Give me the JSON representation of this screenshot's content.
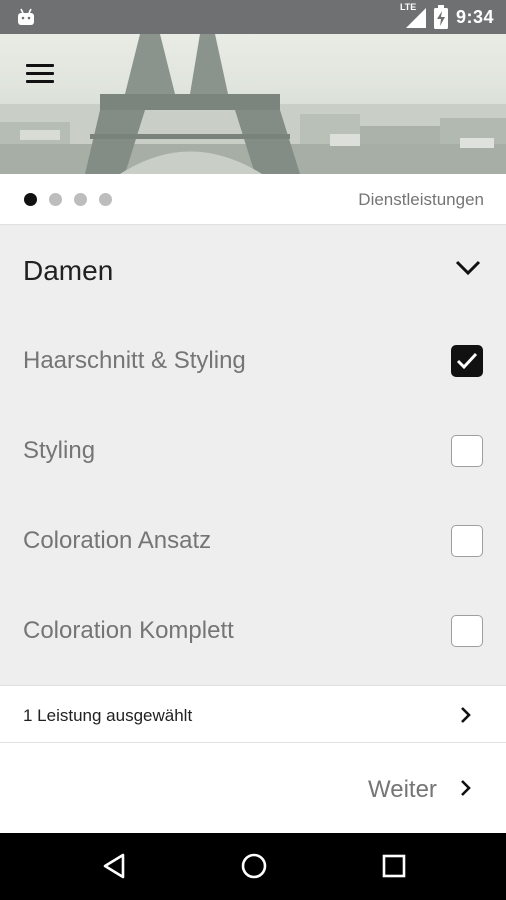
{
  "status_bar": {
    "network": "LTE",
    "time": "9:34",
    "icons": [
      "android-icon",
      "signal-icon",
      "battery-charging-icon"
    ]
  },
  "hero": {
    "image": "eiffel-tower-photo",
    "menu_icon": "hamburger-menu-icon"
  },
  "pager": {
    "total_steps": 4,
    "active_step": 1,
    "step_label": "Dienstleistungen"
  },
  "group": {
    "title": "Damen",
    "expanded": true,
    "icon": "chevron-down-icon"
  },
  "services": [
    {
      "label": "Haarschnitt & Styling",
      "checked": true
    },
    {
      "label": "Styling",
      "checked": false
    },
    {
      "label": "Coloration Ansatz",
      "checked": false
    },
    {
      "label": "Coloration Komplett",
      "checked": false
    }
  ],
  "summary": {
    "text": "1 Leistung ausgewählt"
  },
  "footer": {
    "next_label": "Weiter"
  },
  "nav_bar": {
    "buttons": [
      "back-icon",
      "home-icon",
      "recents-icon"
    ]
  },
  "colors": {
    "status_bar": "#6f7072",
    "list_background": "#eeeeee",
    "accent": "#111111",
    "secondary_text": "#757575"
  }
}
